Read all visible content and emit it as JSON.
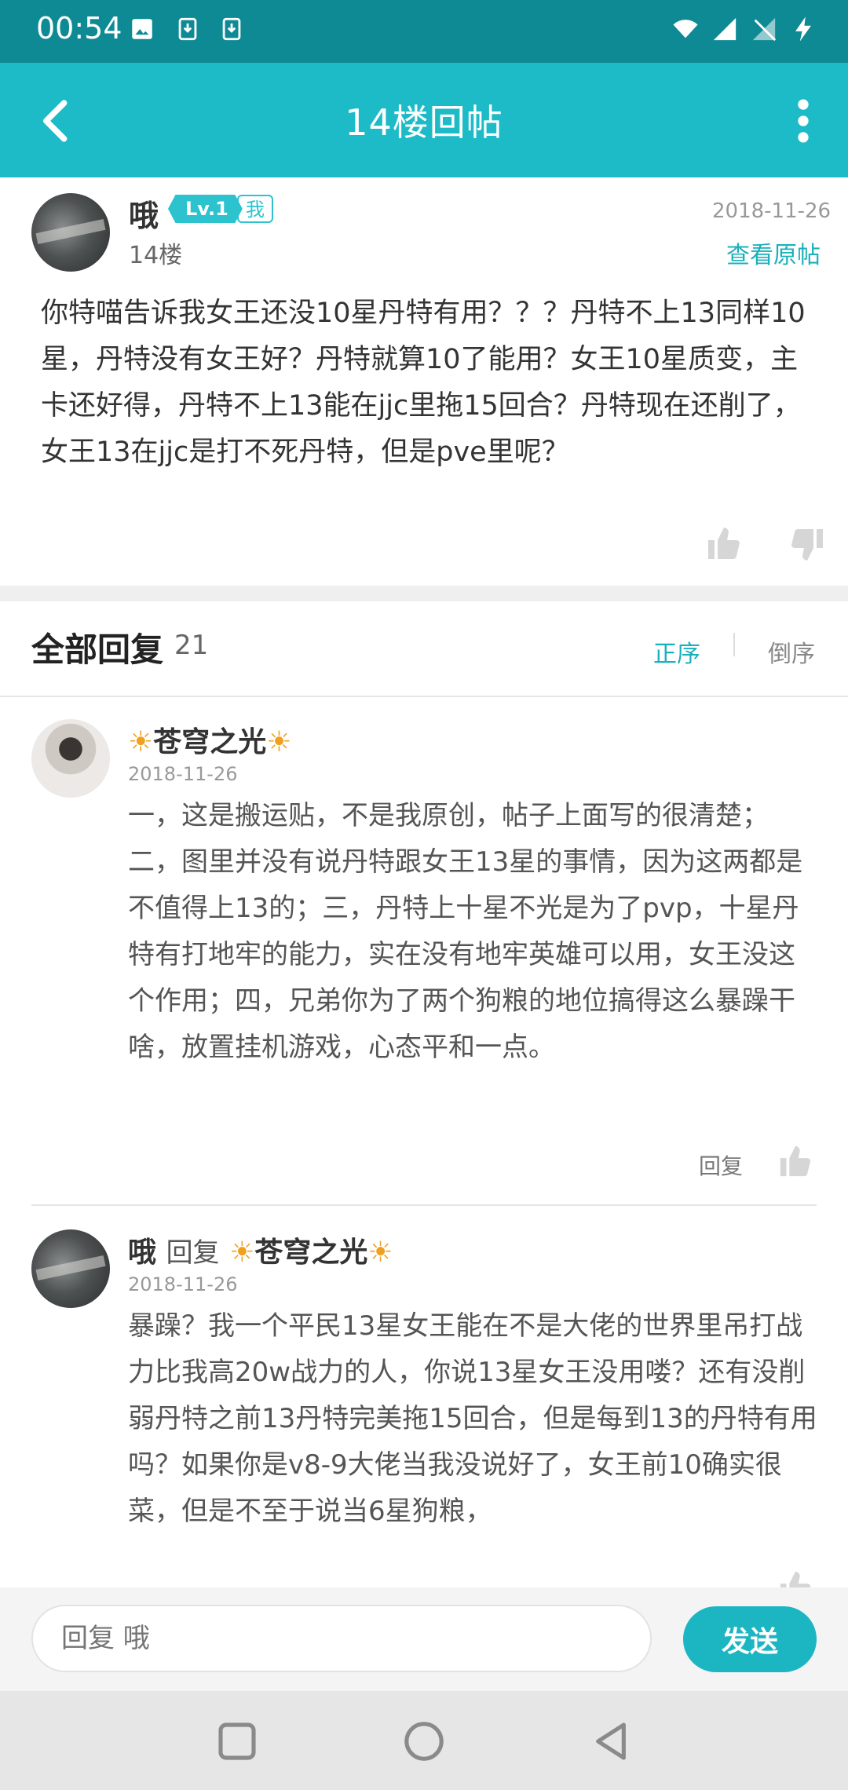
{
  "status_bar": {
    "time": "00:54"
  },
  "header": {
    "title": "14楼回帖"
  },
  "post": {
    "author": "哦",
    "level": "Lv.1",
    "me_badge": "我",
    "floor": "14楼",
    "date": "2018-11-26",
    "view_original": "查看原帖",
    "body": "你特喵告诉我女王还没10星丹特有用？？？丹特不上13同样10星，丹特没有女王好？丹特就算10了能用？女王10星质变，主卡还好得，丹特不上13能在jjc里拖15回合？丹特现在还削了，女王13在jjc是打不死丹特，但是pve里呢？"
  },
  "replies_header": {
    "title": "全部回复",
    "count": "21",
    "sort_asc": "正序",
    "sort_desc": "倒序"
  },
  "replies": [
    {
      "author": "苍穹之光",
      "date": "2018-11-26",
      "body": "一，这是搬运贴，不是我原创，帖子上面写的很清楚；二，图里并没有说丹特跟女王13星的事情，因为这两都是不值得上13的；三，丹特上十星不光是为了pvp，十星丹特有打地牢的能力，实在没有地牢英雄可以用，女王没这个作用；四，兄弟你为了两个狗粮的地位搞得这么暴躁干啥，放置挂机游戏，心态平和一点。",
      "reply_label": "回复"
    },
    {
      "author": "哦",
      "reply_word": "回复",
      "reply_to": "苍穹之光",
      "date": "2018-11-26",
      "body": "暴躁？我一个平民13星女王能在不是大佬的世界里吊打战力比我高20w战力的人，你说13星女王没用喽？还有没削弱丹特之前13丹特完美拖15回合，但是每到13的丹特有用吗？如果你是v8-9大佬当我没说好了，女王前10确实很菜，但是不至于说当6星狗粮，"
    }
  ],
  "bottom_bar": {
    "input_placeholder": "回复 哦",
    "send_label": "发送"
  },
  "colors": {
    "status_bar": "#0e8a94",
    "app_bar": "#1cbbc7",
    "accent": "#1ab0bb"
  }
}
